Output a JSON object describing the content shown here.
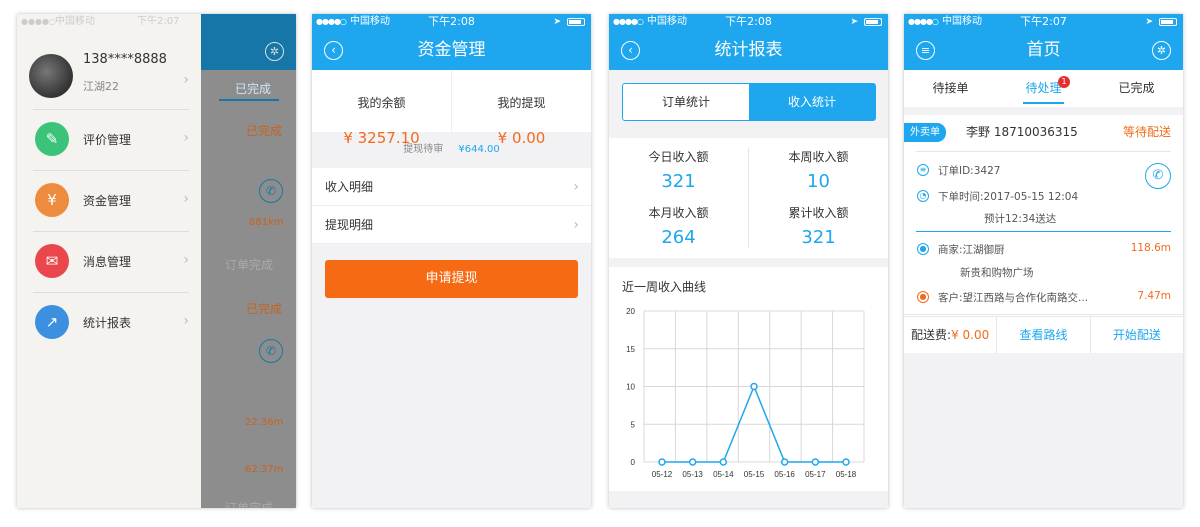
{
  "status": {
    "signal": "●●●●○",
    "carrier": "中国移动",
    "time_1": "下午2:07",
    "time_2": "下午2:08",
    "time_3": "下午2:08",
    "time_4": "下午2:07"
  },
  "screen1": {
    "profile": {
      "phone": "138****8888",
      "name": "江湖22"
    },
    "menu": [
      {
        "label": "评价管理",
        "icon": "review-icon",
        "color": "#3cc37a"
      },
      {
        "label": "资金管理",
        "icon": "wallet-icon",
        "color": "#ef8b3e"
      },
      {
        "label": "消息管理",
        "icon": "mail-icon",
        "color": "#e9474b"
      },
      {
        "label": "统计报表",
        "icon": "chart-icon",
        "color": "#3d8fe0"
      }
    ],
    "behind": {
      "tab_done": "已完成",
      "status1": "已完成",
      "dist1": "881km",
      "status2": "订单完成",
      "status3": "已完成",
      "dist2": "22.36m",
      "dist3": "62.37m",
      "status4": "订单完成"
    }
  },
  "screen2": {
    "title": "资金管理",
    "balance_label": "我的余额",
    "balance_value": "¥ 3257.10",
    "withdraw_label": "我的提现",
    "withdraw_value": "¥ 0.00",
    "pending_label": "提现待审",
    "pending_value": "¥644.00",
    "rows": [
      "收入明细",
      "提现明细"
    ],
    "apply_button": "申请提现"
  },
  "screen3": {
    "title": "统计报表",
    "tab_orders": "订单统计",
    "tab_income": "收入统计",
    "stats": [
      {
        "label": "今日收入额",
        "value": "321"
      },
      {
        "label": "本周收入额",
        "value": "10"
      },
      {
        "label": "本月收入额",
        "value": "264"
      },
      {
        "label": "累计收入额",
        "value": "321"
      }
    ],
    "chart_title": "近一周收入曲线"
  },
  "chart_data": {
    "type": "line",
    "title": "近一周收入曲线",
    "categories": [
      "05-12",
      "05-13",
      "05-14",
      "05-15",
      "05-16",
      "05-17",
      "05-18"
    ],
    "values": [
      0,
      0,
      0,
      10,
      0,
      0,
      0
    ],
    "ylim": [
      0,
      20
    ],
    "yticks": [
      "0",
      "5",
      "10",
      "15",
      "20"
    ],
    "grid": true,
    "color": "#1ea7ee"
  },
  "screen4": {
    "title": "首页",
    "tabs": [
      "待接单",
      "待处理",
      "已完成"
    ],
    "badge": "1",
    "tag": "外卖单",
    "customer": "李野 18710036315",
    "order_status": "等待配送",
    "order_id": "订单ID:3427",
    "order_time": "下单时间:2017-05-15 12:04",
    "eta": "预计12:34送达",
    "merchant": "商家:江湖御厨",
    "merchant_dist": "118.6m",
    "merchant_addr": "新贵和购物广场",
    "client": "客户:望江西路与合作化南路交...",
    "client_dist": "7.47m",
    "fee_label": "配送费:",
    "fee_value": "¥ 0.00",
    "route_button": "查看路线",
    "start_button": "开始配送"
  }
}
